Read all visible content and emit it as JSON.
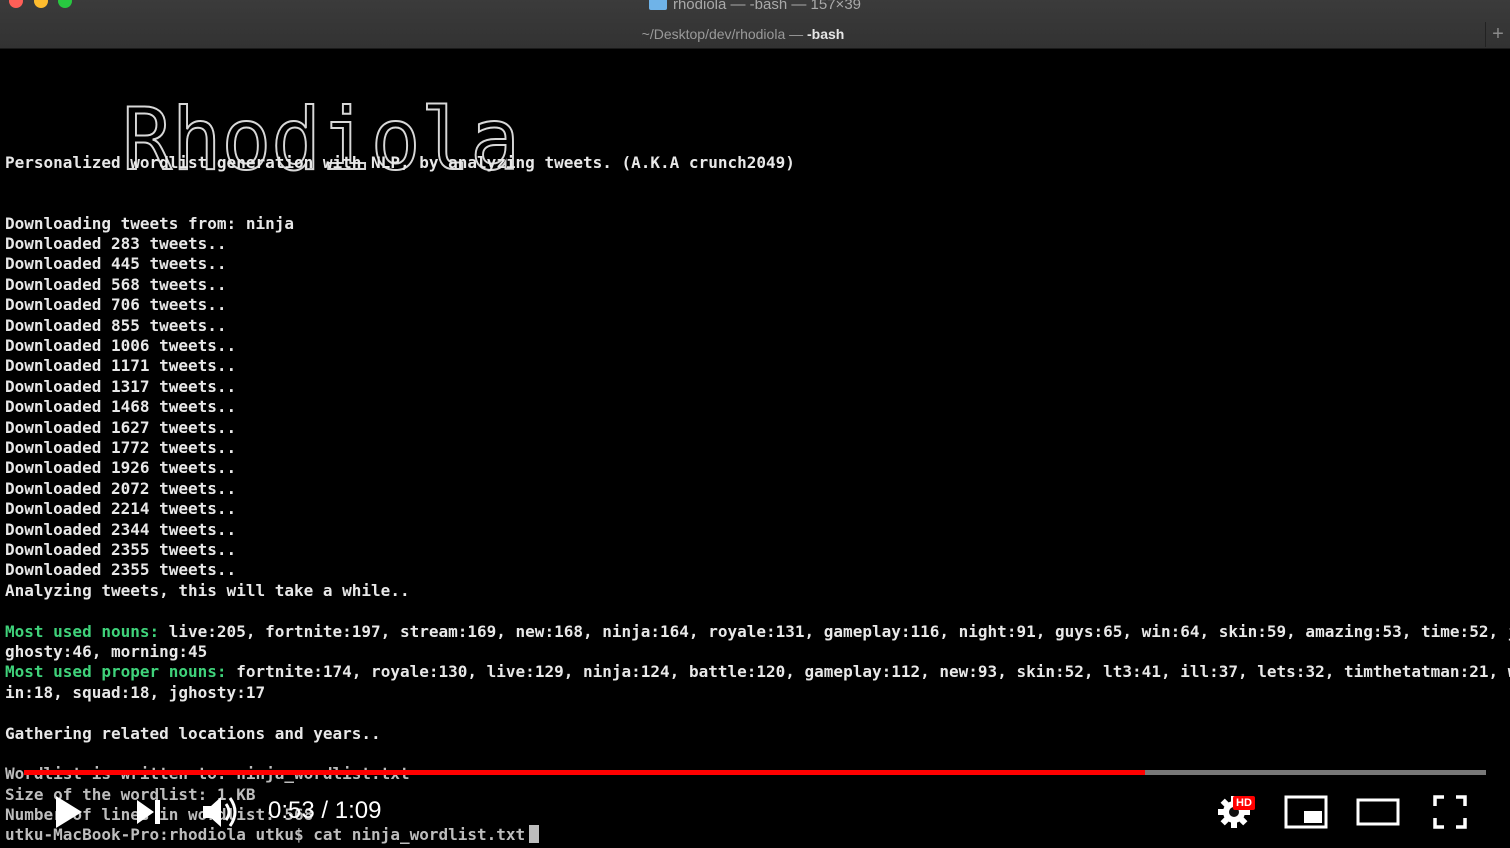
{
  "window": {
    "title": "rhodiola — -bash — 157×39",
    "tab_path": "~/Desktop/dev/rhodiola — ",
    "tab_shell": "-bash",
    "new_tab": "+"
  },
  "terminal": {
    "logo_text": "Rhodiola",
    "tagline": "Personalized wordlist generation with NLP, by analyzing tweets. (A.K.A crunch2049)",
    "downloading": "Downloading tweets from: ninja",
    "downloads": [
      "Downloaded 283 tweets..",
      "Downloaded 445 tweets..",
      "Downloaded 568 tweets..",
      "Downloaded 706 tweets..",
      "Downloaded 855 tweets..",
      "Downloaded 1006 tweets..",
      "Downloaded 1171 tweets..",
      "Downloaded 1317 tweets..",
      "Downloaded 1468 tweets..",
      "Downloaded 1627 tweets..",
      "Downloaded 1772 tweets..",
      "Downloaded 1926 tweets..",
      "Downloaded 2072 tweets..",
      "Downloaded 2214 tweets..",
      "Downloaded 2344 tweets..",
      "Downloaded 2355 tweets..",
      "Downloaded 2355 tweets.."
    ],
    "analyzing": "Analyzing tweets, this will take a while..",
    "nouns_label": "Most used nouns:",
    "nouns_value": " live:205, fortnite:197, stream:169, new:168, ninja:164, royale:131, gameplay:116, night:91, guys:65, win:64, skin:59, amazing:53, time:52, j",
    "nouns_cont": "ghosty:46, morning:45",
    "proper_label": "Most used proper nouns:",
    "proper_value": " fortnite:174, royale:130, live:129, ninja:124, battle:120, gameplay:112, new:93, skin:52, lt3:41, ill:37, lets:32, timthetatman:21, w",
    "proper_cont": "in:18, squad:18, jghosty:17",
    "gathering": "Gathering related locations and years..",
    "written": "Wordlist is written to: ninja_wordlist.txt",
    "size": "Size of the wordlist: 1 KB",
    "lines": "Number of lines in wordlist: 568",
    "prompt": "utku-MacBook-Pro:rhodiola utku$ cat ninja_wordlist.txt"
  },
  "player": {
    "current_time": "0:53",
    "separator": " / ",
    "duration": "1:09",
    "progress": 0.767,
    "hd_badge": "HD",
    "accent": "#ff0000"
  }
}
